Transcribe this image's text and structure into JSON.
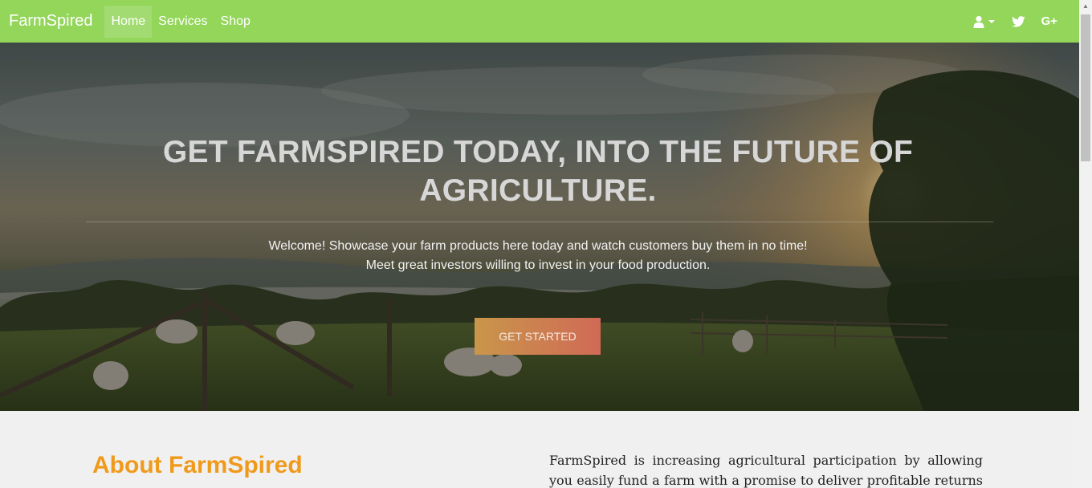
{
  "nav": {
    "brand": "FarmSpired",
    "links": [
      "Home",
      "Services",
      "Shop"
    ],
    "icons": [
      "user-icon",
      "caret-down-icon",
      "twitter-icon",
      "google-plus-icon"
    ],
    "gplus_label": "G+"
  },
  "hero": {
    "title": "GET FARMSPIRED TODAY, INTO THE FUTURE OF AGRICULTURE.",
    "line1": "Welcome! Showcase your farm products here today and watch customers buy them in no time!",
    "line2": "Meet great investors willing to invest in your food production.",
    "cta": "GET STARTED"
  },
  "about": {
    "heading": "About FarmSpired",
    "text": "FarmSpired is increasing agricultural participation by allowing you easily fund a farm with a promise to deliver profitable returns to you"
  },
  "colors": {
    "navbar": "#93d65a",
    "heading_accent": "#f09a1c",
    "cta_start": "#c9964a",
    "cta_end": "#d06a56"
  }
}
